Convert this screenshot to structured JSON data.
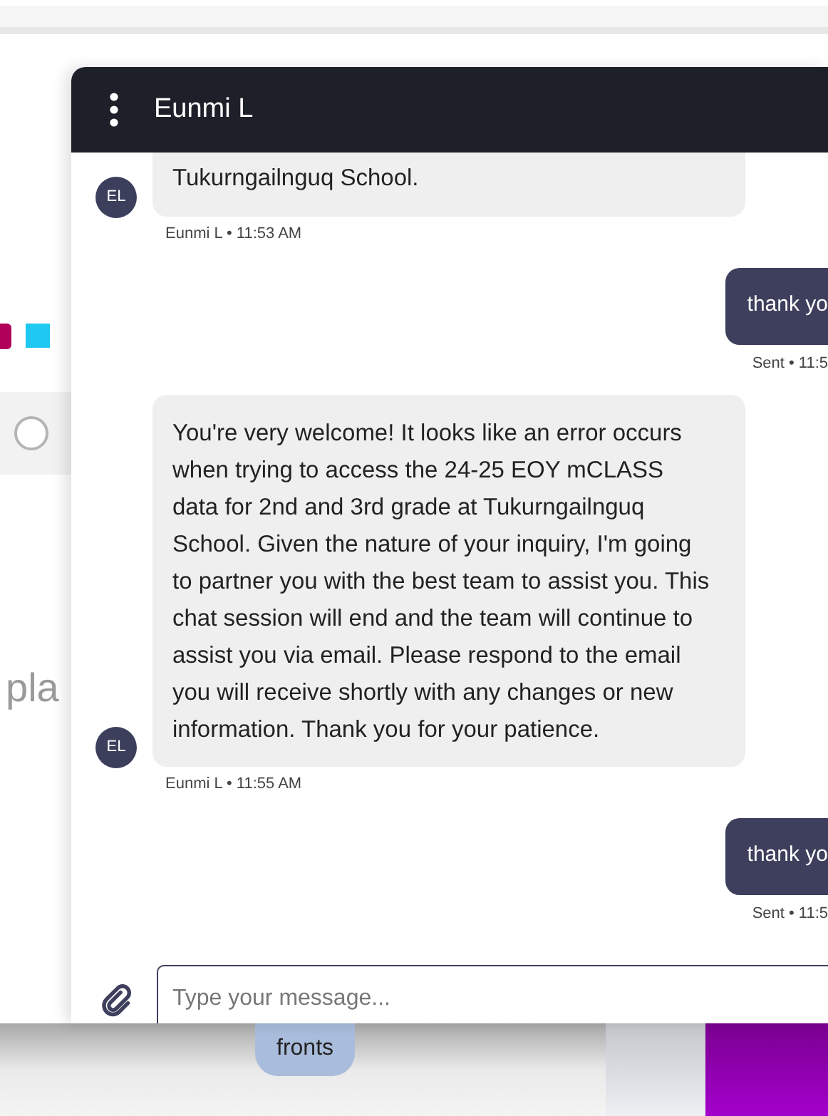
{
  "background_page": {
    "color_squares": [
      {
        "color": "#b0005a"
      },
      {
        "color": "#1ec8f0"
      }
    ],
    "radio": {
      "selected": false
    },
    "partial_text": "pla",
    "chip": "fronts"
  },
  "chat": {
    "title": "Eunmi L",
    "messages": [
      {
        "kind": "received",
        "avatar": "EL",
        "text": "Tukurngailnguq School.",
        "meta": "Eunmi L • 11:53 AM"
      },
      {
        "kind": "sent",
        "text": "thank yo",
        "meta": "Sent • 11:5"
      },
      {
        "kind": "received",
        "avatar": "EL",
        "text": "You're very welcome! It looks like an error occurs when trying to access the 24-25 EOY mCLASS data for 2nd and 3rd grade at Tukurngailnguq School. Given the nature of your inquiry, I'm going to partner you with the best team to assist you. This chat session will end and the team will continue to assist you via email. Please respond to the email you will receive shortly with any changes or new information. Thank you for your patience.",
        "meta": "Eunmi L • 11:55 AM"
      },
      {
        "kind": "sent",
        "text": "thank yo",
        "meta": "Sent • 11:5"
      }
    ],
    "composer": {
      "placeholder": "Type your message..."
    }
  }
}
